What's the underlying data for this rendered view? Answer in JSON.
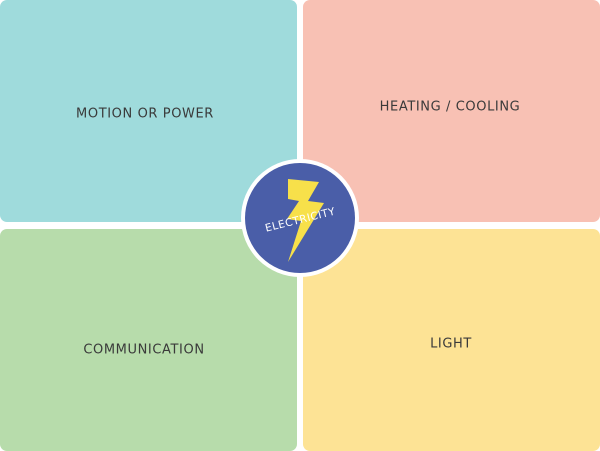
{
  "quadrants": {
    "top_left": {
      "label": "MOTION OR POWER",
      "color": "#9fdbdc"
    },
    "top_right": {
      "label": "HEATING / COOLING",
      "color": "#f8c1b4"
    },
    "bottom_left": {
      "label": "COMMUNICATION",
      "color": "#b7dcab"
    },
    "bottom_right": {
      "label": "LIGHT",
      "color": "#fde395"
    }
  },
  "center": {
    "label": "ELECTRICITY",
    "circle_color": "#4a5ea8",
    "bolt_color": "#f7e04a",
    "icon": "lightning-bolt-icon"
  }
}
